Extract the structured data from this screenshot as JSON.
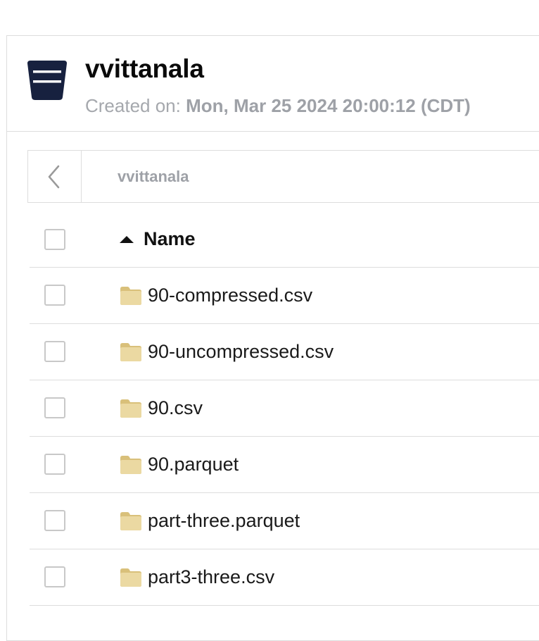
{
  "bucket": {
    "name": "vvittanala",
    "created_label": "Created on:",
    "created_date": "Mon, Mar 25 2024 20:00:12 (CDT)"
  },
  "breadcrumb": {
    "path": "vvittanala"
  },
  "table": {
    "name_header": "Name",
    "sort_direction": "ascending",
    "rows": [
      {
        "name": "90-compressed.csv",
        "icon": "folder-icon"
      },
      {
        "name": "90-uncompressed.csv",
        "icon": "folder-icon"
      },
      {
        "name": "90.csv",
        "icon": "folder-icon"
      },
      {
        "name": "90.parquet",
        "icon": "folder-icon"
      },
      {
        "name": "part-three.parquet",
        "icon": "folder-icon"
      },
      {
        "name": "part3-three.csv",
        "icon": "folder-icon"
      }
    ]
  },
  "colors": {
    "bucket_icon": "#17213f",
    "folder": "#e8d49a",
    "border": "#dddddd",
    "muted_text": "#a5a8ad"
  }
}
